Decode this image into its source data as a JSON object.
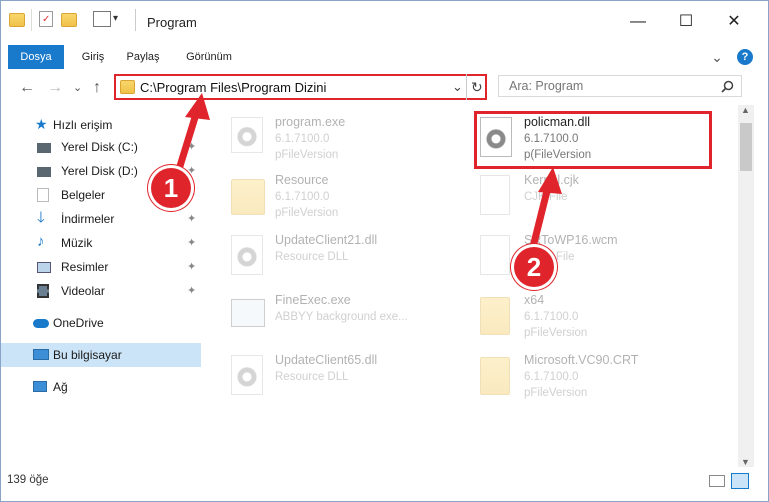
{
  "window": {
    "title": "Program",
    "minimize": "—",
    "maximize": "☐",
    "close": "✕"
  },
  "ribbon": {
    "tabs": [
      "Dosya",
      "Giriş",
      "Paylaş",
      "Görünüm"
    ],
    "expand": "⌄",
    "help": "?"
  },
  "nav": {
    "back": "←",
    "forward": "→",
    "dropdown": "⌄",
    "up": "↑"
  },
  "address": {
    "path": "C:\\Program Files\\Program Dizini",
    "dropdown": "⌄",
    "refresh": "↻"
  },
  "search": {
    "placeholder": "Ara: Program",
    "icon": "search-icon"
  },
  "sidebar": {
    "items": [
      {
        "label": "Hızlı erişim",
        "icon": "star-icon"
      },
      {
        "label": "Yerel Disk (C:)",
        "icon": "drive-icon",
        "pin": "📌"
      },
      {
        "label": "Yerel Disk (D:)",
        "icon": "drive-icon",
        "pin": "📌"
      },
      {
        "label": "Belgeler",
        "icon": "document-icon",
        "pin": "📌"
      },
      {
        "label": "İndirmeler",
        "icon": "download-icon",
        "pin": "📌"
      },
      {
        "label": "Müzik",
        "icon": "music-icon",
        "pin": "📌"
      },
      {
        "label": "Resimler",
        "icon": "picture-icon",
        "pin": "📌"
      },
      {
        "label": "Videolar",
        "icon": "video-icon",
        "pin": "📌"
      },
      {
        "label": "OneDrive",
        "icon": "cloud-icon"
      },
      {
        "label": "Bu bilgisayar",
        "icon": "computer-icon"
      },
      {
        "label": "Ağ",
        "icon": "network-icon"
      }
    ]
  },
  "files": [
    {
      "name": "program.exe",
      "line2": "6.1.7100.0",
      "line3": "pFileVersion"
    },
    {
      "name": "policman.dll",
      "line2": "6.1.7100.0",
      "line3": "p(FileVersion"
    },
    {
      "name": "Resource",
      "line2": "6.1.7100.0",
      "line3": "pFileVersion"
    },
    {
      "name": "Kernel.cjk",
      "line2": "CJK File",
      "line3": ""
    },
    {
      "name": "UpdateClient21.dll",
      "line2": "Resource DLL",
      "line3": ""
    },
    {
      "name": "SRToWP16.wcm",
      "line2": "WCM File",
      "line3": ""
    },
    {
      "name": "FineExec.exe",
      "line2": "ABBYY background exe...",
      "line3": ""
    },
    {
      "name": "x64",
      "line2": "6.1.7100.0",
      "line3": "pFileVersion"
    },
    {
      "name": "UpdateClient65.dll",
      "line2": "Resource DLL",
      "line3": ""
    },
    {
      "name": "Microsoft.VC90.CRT",
      "line2": "6.1.7100.0",
      "line3": "pFileVersion"
    }
  ],
  "status": {
    "count": "139 öğe"
  },
  "annotations": {
    "step1": "1",
    "step2": "2"
  },
  "colors": {
    "accent": "#1979ca",
    "highlight": "#e0242b"
  }
}
